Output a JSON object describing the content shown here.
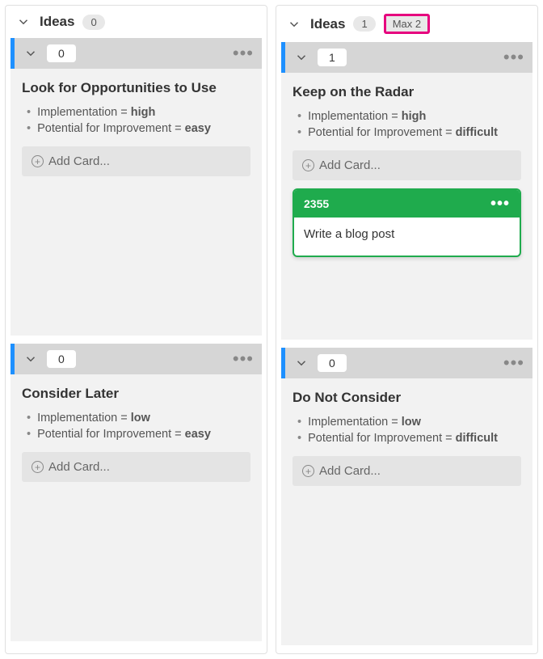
{
  "columns": [
    {
      "title": "Ideas",
      "count": "0",
      "max_label": null,
      "lanes": [
        {
          "count": "0",
          "title": "Look for Opportunities to Use",
          "impl_label": "Implementation = ",
          "impl_value": "high",
          "pot_label": "Potential for Improvement = ",
          "pot_value": "easy",
          "add_label": "Add Card...",
          "cards": []
        },
        {
          "count": "0",
          "title": "Consider Later",
          "impl_label": "Implementation = ",
          "impl_value": "low",
          "pot_label": "Potential for Improvement = ",
          "pot_value": "easy",
          "add_label": "Add Card...",
          "cards": []
        }
      ]
    },
    {
      "title": "Ideas",
      "count": "1",
      "max_label": "Max 2",
      "lanes": [
        {
          "count": "1",
          "title": "Keep on the Radar",
          "impl_label": "Implementation = ",
          "impl_value": "high",
          "pot_label": "Potential for Improvement = ",
          "pot_value": "difficult",
          "add_label": "Add Card...",
          "cards": [
            {
              "id": "2355",
              "text": "Write a blog post"
            }
          ]
        },
        {
          "count": "0",
          "title": "Do Not Consider",
          "impl_label": "Implementation = ",
          "impl_value": "low",
          "pot_label": "Potential for Improvement = ",
          "pot_value": "difficult",
          "add_label": "Add Card...",
          "cards": []
        }
      ]
    }
  ]
}
